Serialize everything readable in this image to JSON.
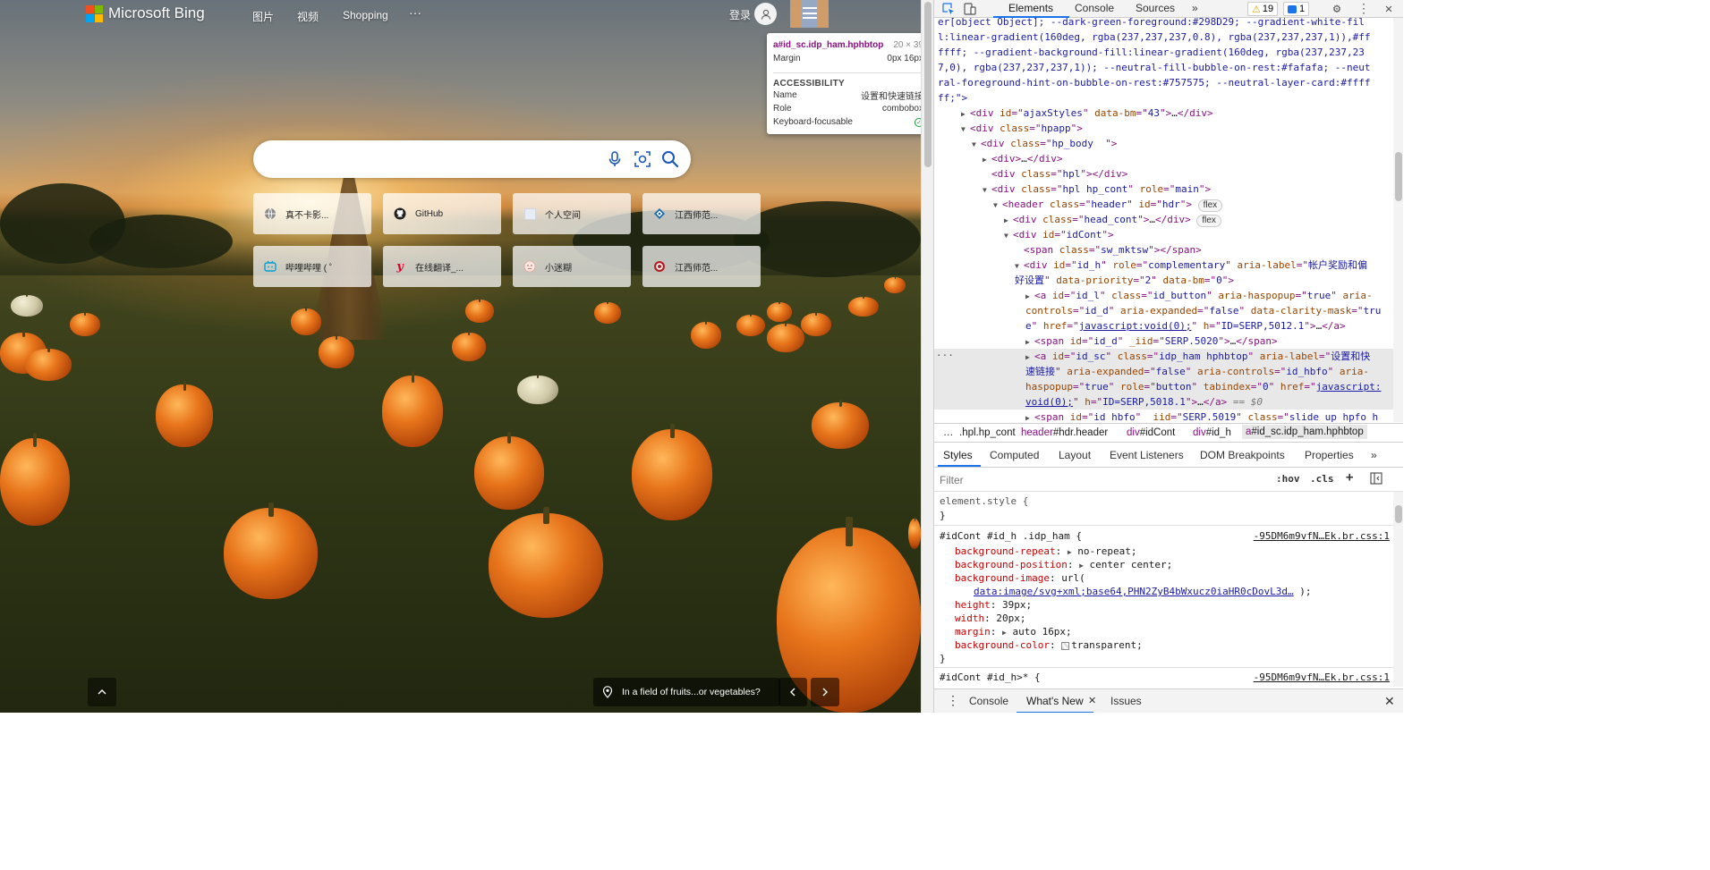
{
  "bing": {
    "logo_text": "Microsoft Bing",
    "nav": [
      "图片",
      "视频",
      "Shopping",
      "···"
    ],
    "signin": "登录",
    "search": {
      "value": "",
      "placeholder": ""
    },
    "icons": {
      "mic": "microphone-icon",
      "visual": "visual-search-icon",
      "search": "search-icon"
    },
    "tiles": [
      {
        "label": "真不卡影...",
        "icon": "globe-icon"
      },
      {
        "label": "GitHub",
        "icon": "github-icon"
      },
      {
        "label": "个人空间",
        "icon": "blank-page-icon"
      },
      {
        "label": "江西师范...",
        "icon": "university-icon"
      },
      {
        "label": "哔哩哔哩 ( ゜",
        "icon": "bilibili-icon"
      },
      {
        "label": "在线翻译_...",
        "icon": "youdao-icon"
      },
      {
        "label": "小迷糊",
        "icon": "face-icon"
      },
      {
        "label": "江西师范...",
        "icon": "university-seal-icon"
      }
    ],
    "image_caption": "In a field of fruits...or vegetables?"
  },
  "tooltip": {
    "element": "a#id_sc.idp_ham.hphbtop",
    "size": "20 × 39",
    "margin_label": "Margin",
    "margin_value": "0px 16px",
    "accessibility": "ACCESSIBILITY",
    "name_label": "Name",
    "name_value": "设置和快速链接",
    "role_label": "Role",
    "role_value": "combobox",
    "focus_label": "Keyboard-focusable"
  },
  "devtools": {
    "tabs": [
      "Elements",
      "Console",
      "Sources",
      "»"
    ],
    "warnings": "19",
    "messages": "1",
    "dom_lines": [
      "er[object Object]; --dark-green-foreground:#298D29; --gradient-white-fil",
      "l:linear-gradient(160deg, rgba(237,237,237,0.8), rgba(237,237,237,1)),#ff",
      "ffff; --gradient-background-fill:linear-gradient(160deg, rgba(237,237,23",
      "7,0), rgba(237,237,237,1)); --neutral-fill-bubble-on-rest:#fafafa; --neut",
      "ral-foreground-hint-on-bubble-on-rest:#757575; --neutral-layer-card:#ffff",
      "ff;\">"
    ],
    "dom": {
      "ajaxStyles": "ajaxStyles",
      "bm43": "43",
      "hpapp": "hpapp",
      "hp_body": "hp_body  ",
      "hpl": "hpl",
      "hpl_hp_cont": "hpl hp_cont",
      "main": "main",
      "header": "header",
      "hdr": "hdr",
      "flex": "flex",
      "head_cont": "head_cont",
      "idCont": "idCont",
      "sw_mktsw": "sw_mktsw",
      "id_h": "id_h",
      "complementary": "complementary",
      "id_h_label": "帐户奖励和偏",
      "id_h_label2": "好设置",
      "id_h_prio": "2",
      "id_h_bm": "0",
      "id_l": "id_l",
      "id_button": "id_button",
      "true": "true",
      "id_d": "id_d",
      "false": "false",
      "clarity": "tru",
      "clarity2": "e",
      "jsvoid": "javascript:void(0);",
      "h_5012": "ID=SERP,5012.1",
      "iid_5020": "SERP.5020",
      "id_sc": "id_sc",
      "idp_ham": "idp_ham hphbtop",
      "sc_label": "设置和快",
      "sc_label2": "速链接",
      "id_hbfo": "id_hbfo",
      "button": "button",
      "tabindex": "0",
      "jsvoid_a": "javascript:",
      "jsvoid_b": "void(0);",
      "h_5018": "ID=SERP,5018.1",
      "eq0": " == $0",
      "iid_5019": "SERP.5019",
      "slide_up": "slide_up hpfo h"
    },
    "breadcrumbs": [
      {
        "tag": "…",
        "rest": ""
      },
      {
        "tag": "",
        "rest": ".hpl.hp_cont"
      },
      {
        "tag": "header",
        "rest": "#hdr.header"
      },
      {
        "tag": "div",
        "rest": "#idCont"
      },
      {
        "tag": "div",
        "rest": "#id_h"
      },
      {
        "tag": "a",
        "rest": "#id_sc.idp_ham.hphbtop"
      }
    ],
    "side_tabs": [
      "Styles",
      "Computed",
      "Layout",
      "Event Listeners",
      "DOM Breakpoints",
      "Properties",
      "»"
    ],
    "filter_placeholder": "Filter",
    "hov": ":hov",
    "cls": ".cls",
    "styles": {
      "element_style": "element.style {",
      "close": "}",
      "rule1_selector": "#idCont #id_h .idp_ham {",
      "rule1_source": "-95DM6m9vfN…Ek.br.css:1",
      "props": [
        {
          "name": "background-repeat",
          "value": "no-repeat;",
          "arrow": true
        },
        {
          "name": "background-position",
          "value": "center center;",
          "arrow": true
        },
        {
          "name": "background-image",
          "value": "url(",
          "arrow": false
        },
        {
          "name": "height",
          "value": "39px;",
          "arrow": false
        },
        {
          "name": "width",
          "value": "20px;",
          "arrow": false
        },
        {
          "name": "margin",
          "value": "auto 16px;",
          "arrow": true
        },
        {
          "name": "background-color",
          "value": "transparent;",
          "arrow": false
        }
      ],
      "url_link": "data:image/svg+xml;base64,PHN2ZyB4bWxucz0iaHR0cDovL3d…",
      "url_tail": " );",
      "rule2_selector": "#idCont #id_h>* {",
      "rule2_source": "-95DM6m9vfN…Ek.br.css:1"
    },
    "drawer_tabs": [
      "Console",
      "What's New",
      "Issues"
    ]
  }
}
